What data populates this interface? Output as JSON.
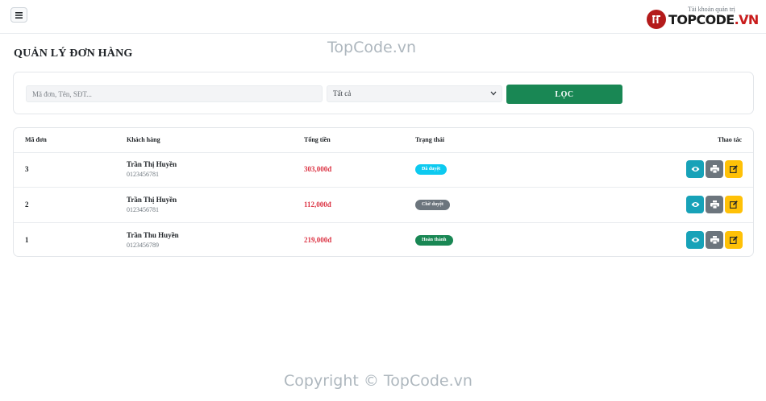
{
  "header": {
    "admin_label": "Tài khoản quản trị",
    "logo": {
      "brand": "TOPCODE",
      "suffix": ".VN"
    }
  },
  "watermarks": {
    "top": "TopCode.vn",
    "bottom": "Copyright © TopCode.vn"
  },
  "page": {
    "title": "QUẢN LÝ ĐƠN HÀNG"
  },
  "filter": {
    "search_placeholder": "Mã đơn, Tên, SĐT...",
    "status_selected": "Tất cả",
    "filter_button": "LỌC"
  },
  "table": {
    "headers": {
      "id": "Mã đơn",
      "customer": "Khách hàng",
      "total": "Tổng tiền",
      "status": "Trạng thái",
      "actions": "Thao tác"
    },
    "rows": [
      {
        "id": "3",
        "name": "Trần Thị Huyền",
        "phone": "0123456781",
        "total": "303,000đ",
        "status": "Đã duyệt",
        "status_color": "#0dcaf0"
      },
      {
        "id": "2",
        "name": "Trần Thị Huyền",
        "phone": "0123456781",
        "total": "112,000đ",
        "status": "Chờ duyệt",
        "status_color": "#6c757d"
      },
      {
        "id": "1",
        "name": "Trần Thu Huyền",
        "phone": "0123456789",
        "total": "219,000đ",
        "status": "Hoàn thành",
        "status_color": "#198754"
      }
    ]
  },
  "colors": {
    "primary": "#198754",
    "danger": "#dc3545",
    "info": "#17a2b8",
    "secondary": "#6c757d",
    "warning": "#ffc107"
  },
  "icons": {
    "menu": "hamburger-icon",
    "view": "eye-icon",
    "print": "printer-icon",
    "edit": "edit-icon",
    "dropdown": "chevron-down-icon"
  }
}
